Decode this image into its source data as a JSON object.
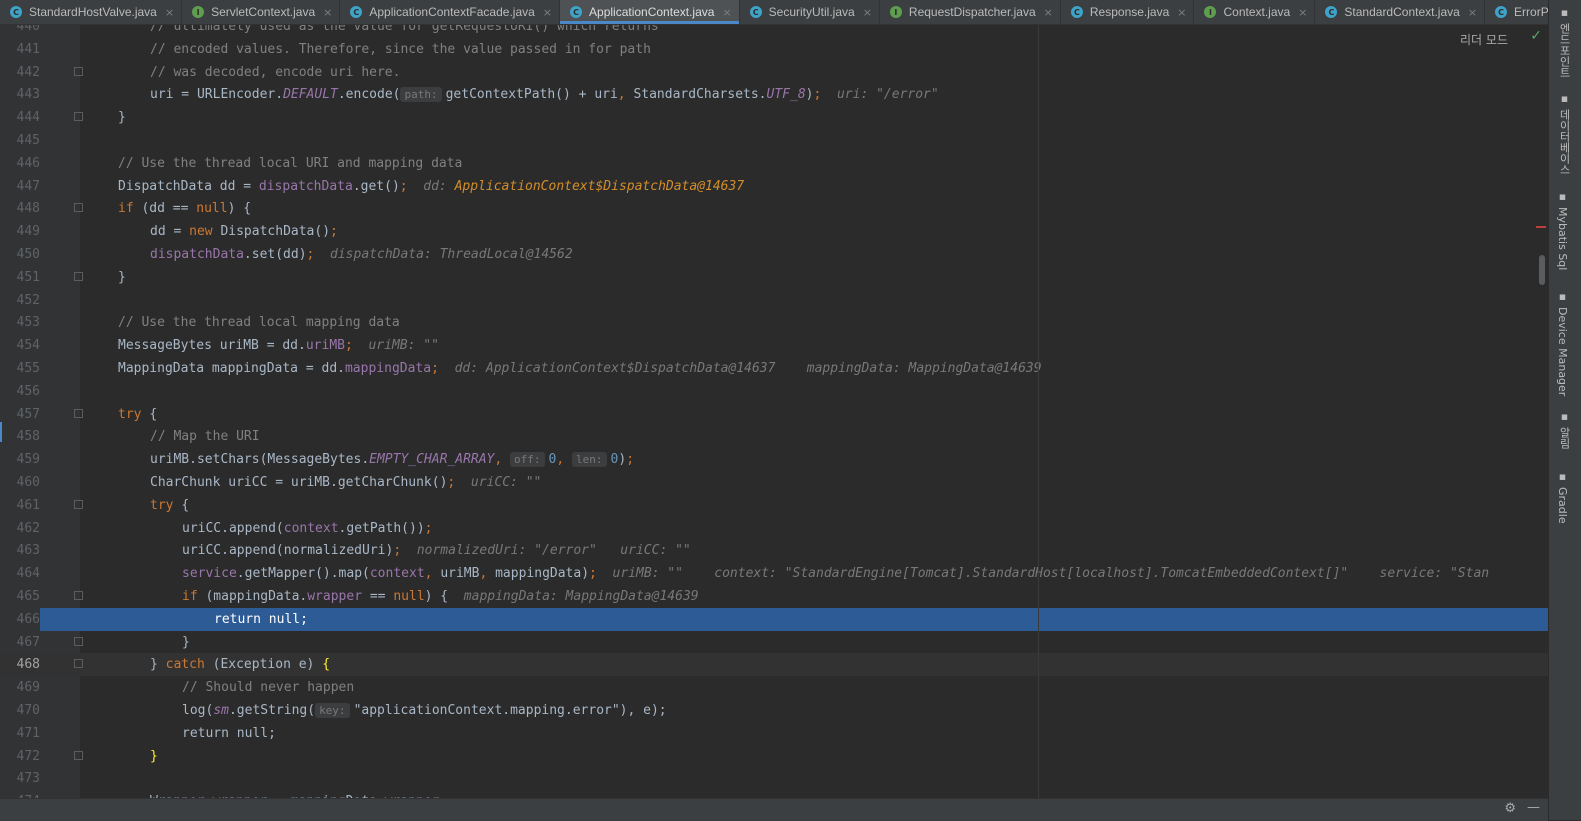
{
  "tabs": [
    {
      "label": "StandardHostValve.java",
      "kind": "class",
      "active": false
    },
    {
      "label": "ServletContext.java",
      "kind": "iface",
      "active": false
    },
    {
      "label": "ApplicationContextFacade.java",
      "kind": "class",
      "active": false
    },
    {
      "label": "ApplicationContext.java",
      "kind": "class",
      "active": true
    },
    {
      "label": "SecurityUtil.java",
      "kind": "class",
      "active": false
    },
    {
      "label": "RequestDispatcher.java",
      "kind": "iface",
      "active": false
    },
    {
      "label": "Response.java",
      "kind": "class",
      "active": false
    },
    {
      "label": "Context.java",
      "kind": "iface",
      "active": false
    },
    {
      "label": "StandardContext.java",
      "kind": "class",
      "active": false
    },
    {
      "label": "ErrorPa",
      "kind": "class",
      "active": false
    }
  ],
  "reader_mode": "리더 모드",
  "right_panels": [
    {
      "label": "엔드포인트",
      "icon": "endpoints-icon"
    },
    {
      "label": "데이터베이스",
      "icon": "database-icon"
    },
    {
      "label": "Mybatis Sql",
      "icon": "mybatis-icon"
    },
    {
      "label": "Device Manager",
      "icon": "device-manager-icon"
    },
    {
      "label": "알림",
      "icon": "notifications-icon"
    },
    {
      "label": "Gradle",
      "icon": "gradle-icon"
    }
  ],
  "colors": {
    "accent": "#4a88c7",
    "exec_line": "#2d5b96",
    "keyword": "#cc7832",
    "field": "#9876aa"
  },
  "code_lines": [
    {
      "num": "440",
      "indent": 3,
      "tokens": [
        [
          "cm",
          "// ultimately used as the value for getRequestURI() which returns"
        ]
      ]
    },
    {
      "num": "441",
      "indent": 3,
      "tokens": [
        [
          "cm",
          "// encoded values. Therefore, since the value passed in for path"
        ]
      ]
    },
    {
      "num": "442",
      "indent": 3,
      "fold": true,
      "tokens": [
        [
          "cm",
          "// was decoded, encode uri here."
        ]
      ]
    },
    {
      "num": "443",
      "indent": 3,
      "tokens": [
        [
          "p",
          "uri = URLEncoder."
        ],
        [
          "sfld",
          "DEFAULT"
        ],
        [
          "p",
          ".encode("
        ],
        [
          "hint",
          "path:"
        ],
        [
          "p",
          "getContextPath() + uri"
        ],
        [
          "kw",
          ", "
        ],
        [
          "p",
          "StandardCharsets."
        ],
        [
          "sfld",
          "UTF_8"
        ],
        [
          "p",
          ")"
        ],
        [
          "kw",
          ";"
        ],
        [
          "sp",
          "  "
        ],
        [
          "inl",
          "uri: \"/error\""
        ]
      ]
    },
    {
      "num": "444",
      "indent": 2,
      "fold": true,
      "tokens": [
        [
          "p",
          "}"
        ]
      ]
    },
    {
      "num": "445",
      "indent": 0,
      "tokens": []
    },
    {
      "num": "446",
      "indent": 2,
      "tokens": [
        [
          "cm",
          "// Use the thread local URI and mapping data"
        ]
      ]
    },
    {
      "num": "447",
      "indent": 2,
      "tokens": [
        [
          "p",
          "DispatchData dd = "
        ],
        [
          "fld",
          "dispatchData"
        ],
        [
          "p",
          ".get()"
        ],
        [
          "kw",
          ";"
        ],
        [
          "sp",
          "  "
        ],
        [
          "inl",
          "dd: "
        ],
        [
          "inlc",
          "ApplicationContext$DispatchData@14637"
        ]
      ]
    },
    {
      "num": "448",
      "indent": 2,
      "fold": true,
      "tokens": [
        [
          "kw",
          "if "
        ],
        [
          "p",
          "(dd == "
        ],
        [
          "kw",
          "null"
        ],
        [
          "p",
          ") {"
        ]
      ]
    },
    {
      "num": "449",
      "indent": 3,
      "tokens": [
        [
          "p",
          "dd = "
        ],
        [
          "kw",
          "new "
        ],
        [
          "p",
          "DispatchData()"
        ],
        [
          "kw",
          ";"
        ]
      ]
    },
    {
      "num": "450",
      "indent": 3,
      "tokens": [
        [
          "fld",
          "dispatchData"
        ],
        [
          "p",
          ".set(dd)"
        ],
        [
          "kw",
          ";"
        ],
        [
          "sp",
          "  "
        ],
        [
          "inl",
          "dispatchData: ThreadLocal@14562"
        ]
      ]
    },
    {
      "num": "451",
      "indent": 2,
      "fold": true,
      "tokens": [
        [
          "p",
          "}"
        ]
      ]
    },
    {
      "num": "452",
      "indent": 0,
      "tokens": []
    },
    {
      "num": "453",
      "indent": 2,
      "tokens": [
        [
          "cm",
          "// Use the thread local mapping data"
        ]
      ]
    },
    {
      "num": "454",
      "indent": 2,
      "tokens": [
        [
          "p",
          "MessageBytes uriMB = dd."
        ],
        [
          "fld",
          "uriMB"
        ],
        [
          "kw",
          ";"
        ],
        [
          "sp",
          "  "
        ],
        [
          "inl",
          "uriMB: \"\""
        ]
      ]
    },
    {
      "num": "455",
      "indent": 2,
      "tokens": [
        [
          "p",
          "MappingData mappingData = dd."
        ],
        [
          "fld",
          "mappingData"
        ],
        [
          "kw",
          ";"
        ],
        [
          "sp",
          "  "
        ],
        [
          "inl",
          "dd: ApplicationContext$DispatchData@14637    mappingData: MappingData@14639"
        ]
      ]
    },
    {
      "num": "456",
      "indent": 0,
      "tokens": []
    },
    {
      "num": "457",
      "indent": 2,
      "fold": true,
      "tokens": [
        [
          "kw",
          "try "
        ],
        [
          "p",
          "{"
        ]
      ]
    },
    {
      "num": "458",
      "indent": 3,
      "tokens": [
        [
          "cm",
          "// Map the URI"
        ]
      ]
    },
    {
      "num": "459",
      "indent": 3,
      "tokens": [
        [
          "p",
          "uriMB.setChars(MessageBytes."
        ],
        [
          "sfld",
          "EMPTY_CHAR_ARRAY"
        ],
        [
          "kw",
          ", "
        ],
        [
          "hint",
          "off:"
        ],
        [
          "num",
          "0"
        ],
        [
          "kw",
          ", "
        ],
        [
          "hint",
          "len:"
        ],
        [
          "num",
          "0"
        ],
        [
          "p",
          ")"
        ],
        [
          "kw",
          ";"
        ]
      ]
    },
    {
      "num": "460",
      "indent": 3,
      "tokens": [
        [
          "p",
          "CharChunk uriCC = uriMB.getCharChunk()"
        ],
        [
          "kw",
          ";"
        ],
        [
          "sp",
          "  "
        ],
        [
          "inl",
          "uriCC: \"\""
        ]
      ]
    },
    {
      "num": "461",
      "indent": 3,
      "fold": true,
      "tokens": [
        [
          "kw",
          "try "
        ],
        [
          "p",
          "{"
        ]
      ]
    },
    {
      "num": "462",
      "indent": 4,
      "tokens": [
        [
          "p",
          "uriCC.append("
        ],
        [
          "fld",
          "context"
        ],
        [
          "p",
          ".getPath())"
        ],
        [
          "kw",
          ";"
        ]
      ]
    },
    {
      "num": "463",
      "indent": 4,
      "tokens": [
        [
          "p",
          "uriCC.append(normalizedUri)"
        ],
        [
          "kw",
          ";"
        ],
        [
          "sp",
          "  "
        ],
        [
          "inl",
          "normalizedUri: \"/error\"   uriCC: \"\""
        ]
      ]
    },
    {
      "num": "464",
      "indent": 4,
      "tokens": [
        [
          "fld",
          "service"
        ],
        [
          "p",
          ".getMapper().map("
        ],
        [
          "fld",
          "context"
        ],
        [
          "kw",
          ", "
        ],
        [
          "p",
          "uriMB"
        ],
        [
          "kw",
          ", "
        ],
        [
          "p",
          "mappingData)"
        ],
        [
          "kw",
          ";"
        ],
        [
          "sp",
          "  "
        ],
        [
          "inl",
          "uriMB: \"\"    context: \"StandardEngine[Tomcat].StandardHost[localhost].TomcatEmbeddedContext[]\"    service: \"Stan"
        ]
      ]
    },
    {
      "num": "465",
      "indent": 4,
      "fold": true,
      "tokens": [
        [
          "kw",
          "if "
        ],
        [
          "p",
          "(mappingData."
        ],
        [
          "fld",
          "wrapper"
        ],
        [
          "p",
          " == "
        ],
        [
          "kw",
          "null"
        ],
        [
          "p",
          ") {"
        ],
        [
          "sp",
          "  "
        ],
        [
          "inl",
          "mappingData: MappingData@14639"
        ]
      ]
    },
    {
      "num": "466",
      "indent": 5,
      "exec": true,
      "tokens": [
        [
          "p",
          "return null;"
        ]
      ]
    },
    {
      "num": "467",
      "indent": 4,
      "fold": true,
      "tokens": [
        [
          "p",
          "}"
        ]
      ]
    },
    {
      "num": "468",
      "indent": 3,
      "fold": true,
      "caret": true,
      "tokens": [
        [
          "p",
          "} "
        ],
        [
          "kw",
          "catch "
        ],
        [
          "p",
          "(Exception e) "
        ],
        [
          "brace",
          "{"
        ]
      ]
    },
    {
      "num": "469",
      "indent": 4,
      "tokens": [
        [
          "cm",
          "// Should never happen"
        ]
      ]
    },
    {
      "num": "470",
      "indent": 4,
      "tokens": [
        [
          "p",
          "log("
        ],
        [
          "sfld",
          "sm"
        ],
        [
          "p",
          ".getString("
        ],
        [
          "hint",
          "key:"
        ],
        [
          "p",
          "\"applicationContext.mapping.error\"), e);"
        ]
      ]
    },
    {
      "num": "471",
      "indent": 4,
      "tokens": [
        [
          "p",
          "return null;"
        ]
      ]
    },
    {
      "num": "472",
      "indent": 3,
      "fold": true,
      "tokens": [
        [
          "brace",
          "}"
        ]
      ]
    },
    {
      "num": "473",
      "indent": 0,
      "tokens": []
    },
    {
      "num": "474",
      "indent": 3,
      "tokens": [
        [
          "p",
          "Wrapper wrapper = mappingData.wrapper;"
        ]
      ]
    }
  ]
}
